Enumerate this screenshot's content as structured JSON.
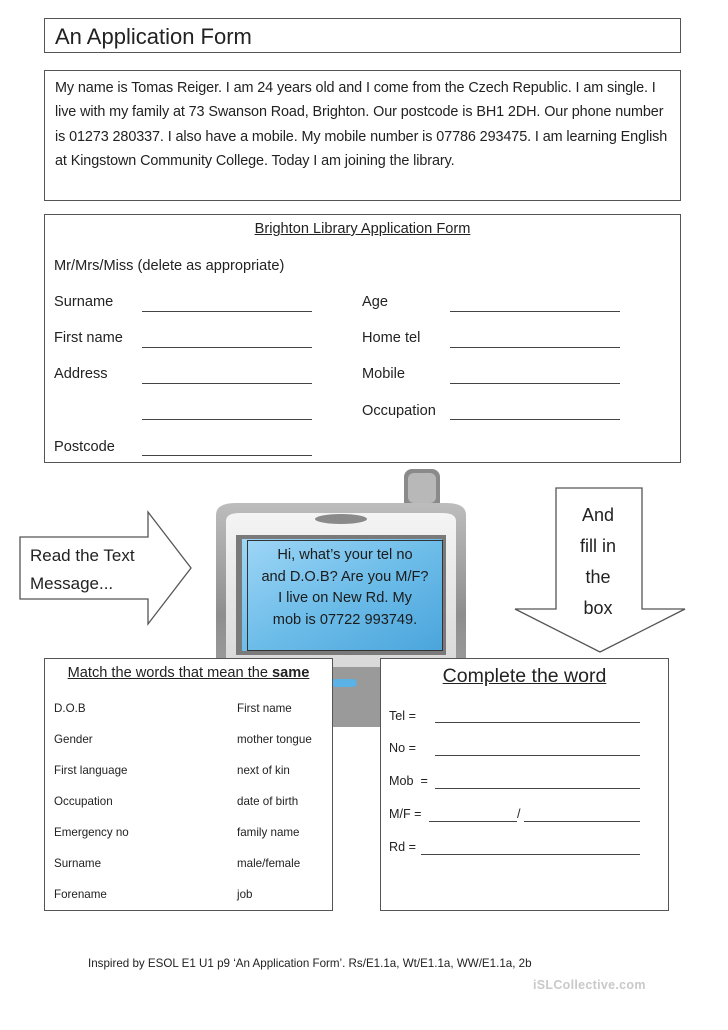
{
  "title": "An Application Form",
  "intro_text": "My name is Tomas Reiger. I am 24 years old and I come from the Czech Republic. I am single. I live with my family at 73 Swanson Road, Brighton. Our postcode is BH1 2DH. Our phone number is 01273 280337. I also have a mobile. My mobile number is 07786 293475. I am learning English at Kingstown Community College. Today I am joining the library.",
  "library_form": {
    "title": "Brighton Library Application Form",
    "salutation": "Mr/Mrs/Miss (delete as appropriate)",
    "left_fields": [
      {
        "label": "Surname",
        "value": ""
      },
      {
        "label": "First name",
        "value": ""
      },
      {
        "label": "Address",
        "value": ""
      },
      {
        "label": "",
        "value": ""
      },
      {
        "label": "Postcode",
        "value": ""
      }
    ],
    "right_fields": [
      {
        "label": "Age",
        "value": ""
      },
      {
        "label": "Home tel",
        "value": ""
      },
      {
        "label": "Mobile",
        "value": ""
      },
      {
        "label": "Occupation",
        "value": ""
      }
    ]
  },
  "arrows": {
    "left_text": [
      "Read the Text",
      "Message..."
    ],
    "right_text": [
      "And",
      "fill in",
      "the",
      "box"
    ]
  },
  "phone_message": [
    "Hi, what’s your tel no",
    "and D.O.B? Are you M/F?",
    "I live on New Rd. My",
    "mob is 07722 993749."
  ],
  "match": {
    "title_prefix": "Match the words that mean the ",
    "title_bold": "same",
    "left": [
      "D.O.B",
      "Gender",
      "First language",
      "Occupation",
      "Emergency no",
      "Surname",
      "Forename"
    ],
    "right": [
      "First name",
      "mother tongue",
      "next of kin",
      "date of birth",
      "family name",
      "male/female",
      "job"
    ]
  },
  "complete": {
    "title": "Complete the word",
    "items": [
      {
        "label": "Tel ="
      },
      {
        "label": "No ="
      },
      {
        "label": "Mob  ="
      },
      {
        "label": "M/F =",
        "separator": "/"
      },
      {
        "label": "Rd ="
      }
    ]
  },
  "footer": "Inspired by ESOL E1 U1 p9 ‘An Application Form’. Rs/E1.1a, Wt/E1.1a, WW/E1.1a, 2b",
  "watermark": "iSLCollective.com",
  "colors": {
    "screen_blue": "#7cc4ef",
    "phone_grey": "#8c8c8c",
    "border": "#555555"
  }
}
